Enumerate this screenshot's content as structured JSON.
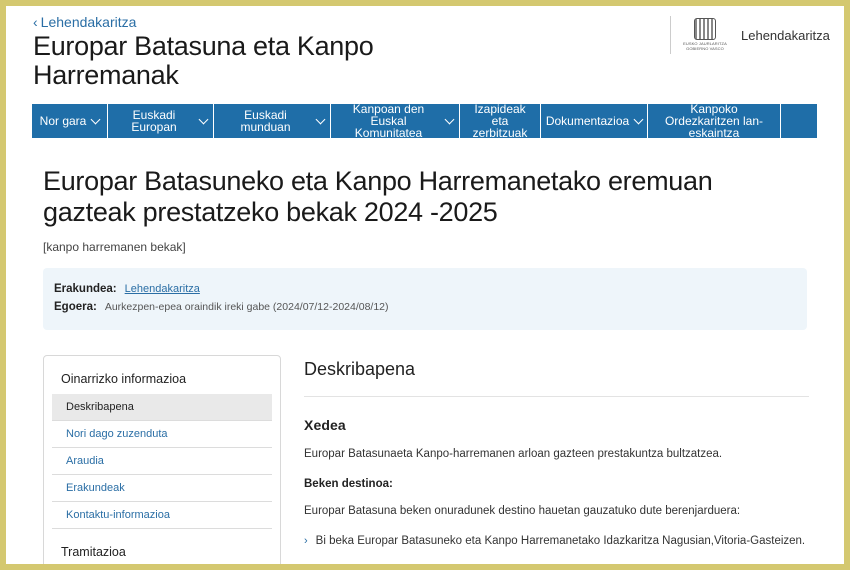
{
  "header": {
    "back_link": "Lehendakaritza",
    "site_title": "Europar Batasuna eta Kanpo Harremanak",
    "gov_logo_caption": "EUSKO JAURLARITZA GOBIERNO VASCO",
    "gov_name": "Lehendakaritza"
  },
  "nav": {
    "items": [
      {
        "label": "Nor gara"
      },
      {
        "label": "Euskadi Europan"
      },
      {
        "label": "Euskadi munduan"
      },
      {
        "label": "Kanpoan den Euskal Komunitatea"
      },
      {
        "label": "Izapideak eta zerbitzuak"
      },
      {
        "label": "Dokumentazioa"
      },
      {
        "label": "Kanpoko Ordezkaritzen lan-eskaintza"
      }
    ]
  },
  "main": {
    "title": "Europar Batasuneko eta Kanpo Harremanetako eremuan gazteak prestatzeko bekak 2024 -2025",
    "subtitle": "[kanpo harremanen bekak]",
    "info": {
      "org_label": "Erakundea:",
      "org_value": "Lehendakaritza",
      "status_label": "Egoera:",
      "status_value": "Aurkezpen-epea oraindik ireki gabe (2024/07/12-2024/08/12)"
    }
  },
  "sidebar": {
    "heading": "Oinarrizko informazioa",
    "items": [
      {
        "label": "Deskribapena"
      },
      {
        "label": "Nori dago zuzenduta"
      },
      {
        "label": "Araudia"
      },
      {
        "label": "Erakundeak"
      },
      {
        "label": "Kontaktu-informazioa"
      }
    ],
    "heading2": "Tramitazioa"
  },
  "content": {
    "heading": "Deskribapena",
    "section_title": "Xedea",
    "paragraph1": "Europar Batasunaeta Kanpo-harremanen arloan gazteen prestakuntza bultzatzea.",
    "bold_label": "Beken destinoa:",
    "paragraph2": "Europar Batasuna beken onuradunek destino hauetan gauzatuko dute berenjarduera:",
    "list_item1": "Bi beka Europar Batasuneko eta Kanpo Harremanetako Idazkaritza Nagusian,Vitoria-Gasteizen."
  }
}
